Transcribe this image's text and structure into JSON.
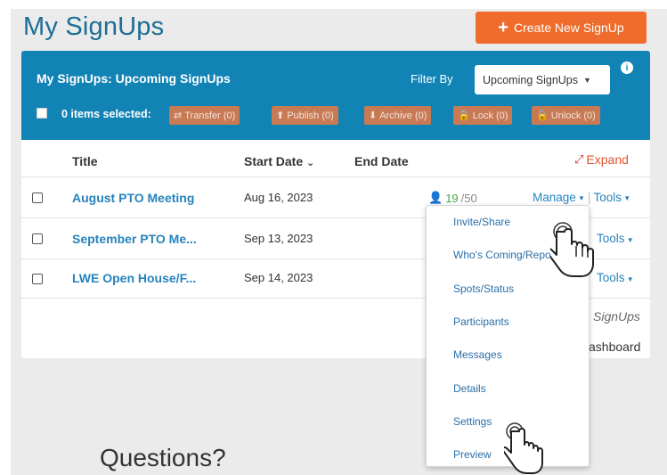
{
  "header": {
    "title": "My SignUps",
    "create_button": "Create New SignUp"
  },
  "panel": {
    "title": "My SignUps: Upcoming SignUps",
    "filter_label": "Filter By",
    "filter_value": "Upcoming SignUps",
    "items_selected": "0 items selected:",
    "bulk_actions": [
      {
        "icon": "transfer-icon",
        "glyph": "⇄",
        "label": "Transfer (0)"
      },
      {
        "icon": "publish-icon",
        "glyph": "⬆",
        "label": "Publish (0)"
      },
      {
        "icon": "archive-icon",
        "glyph": "⬇",
        "label": "Archive (0)"
      },
      {
        "icon": "lock-icon",
        "glyph": "🔒",
        "label": "Lock (0)"
      },
      {
        "icon": "unlock-icon",
        "glyph": "🔓",
        "label": "Unlock (0)"
      }
    ]
  },
  "table": {
    "columns": {
      "title": "Title",
      "start_date": "Start Date",
      "end_date": "End Date",
      "expand": "Expand"
    },
    "rows": [
      {
        "title": "August PTO Meeting",
        "start_date": "Aug 16, 2023",
        "count_done": "19",
        "count_total": "/50",
        "manage": "Manage",
        "tools": "Tools"
      },
      {
        "title": "September PTO Me...",
        "start_date": "Sep 13, 2023",
        "tools": "Tools"
      },
      {
        "title": "LWE Open House/F...",
        "start_date": "Sep 14, 2023",
        "tools": "Tools"
      }
    ],
    "footer_links": [
      "SignUps",
      "ashboard"
    ]
  },
  "manage_menu": {
    "items": [
      "Invite/Share",
      "Who's Coming/Report",
      "Spots/Status",
      "Participants",
      "Messages",
      "Details",
      "Settings",
      "Preview"
    ]
  },
  "footer": {
    "questions": "Questions?"
  },
  "colors": {
    "brand_blue": "#1283b5",
    "link_blue": "#2783bc",
    "orange": "#ef6c2c",
    "title_blue": "#1d6e96"
  }
}
